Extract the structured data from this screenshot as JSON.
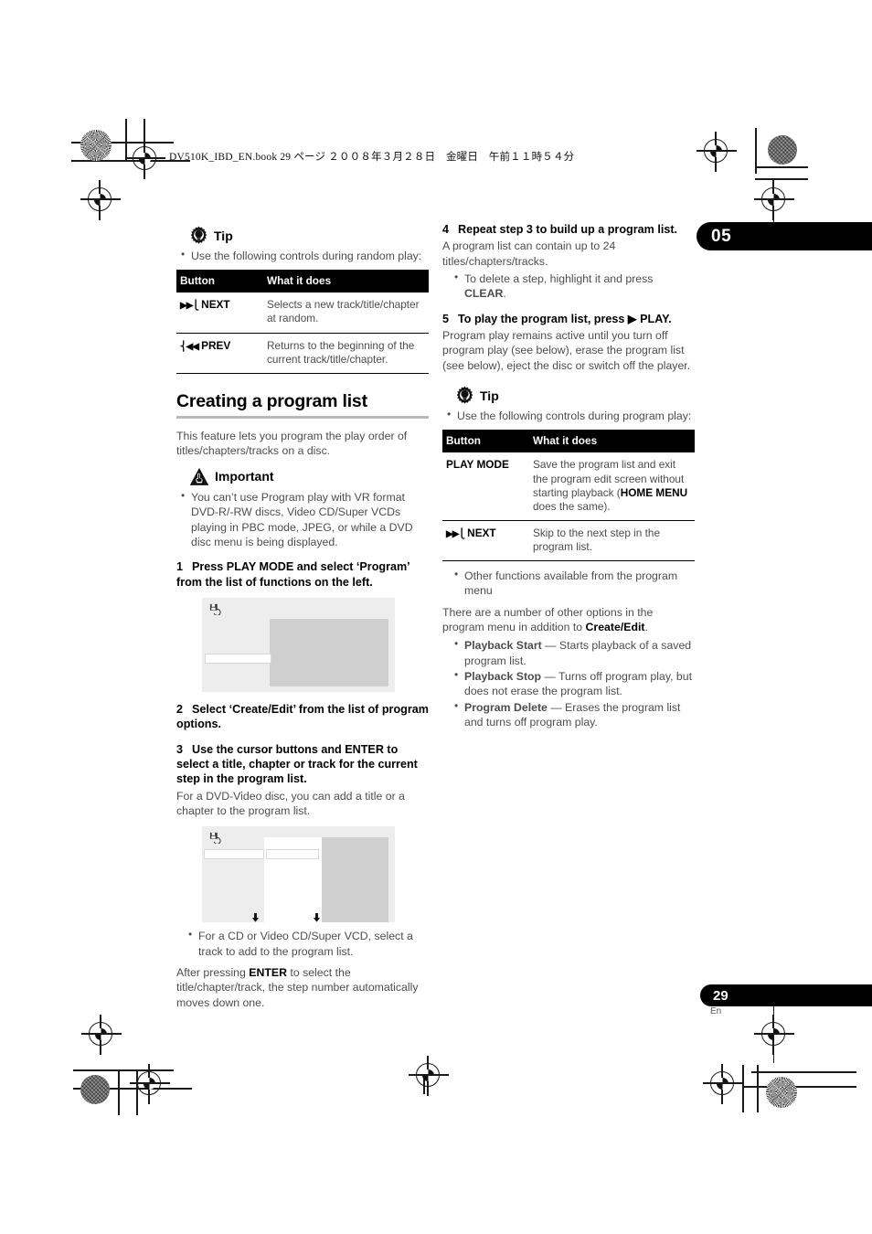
{
  "print": {
    "running_head": "DV510K_IBD_EN.book   29 ページ   ２００８年３月２８日　金曜日　午前１１時５４分"
  },
  "chapter_tab": {
    "number": "05"
  },
  "page_tab": {
    "number": "29",
    "language": "En"
  },
  "left_column": {
    "tip": {
      "icon": "gear-icon",
      "heading": "Tip",
      "bullets": [
        "Use the following controls during random play:"
      ],
      "table": {
        "headers": [
          "Button",
          "What it does"
        ],
        "rows": [
          {
            "glyph": "▶▶⎩",
            "button": "NEXT",
            "desc": "Selects a new track/title/chapter at random."
          },
          {
            "glyph": "⎨◀◀",
            "button": "PREV",
            "desc": "Returns to the beginning of the current track/title/chapter."
          }
        ]
      }
    },
    "section": {
      "title": "Creating a program list",
      "intro": "This feature lets you program the play order of titles/chapters/tracks on a disc.",
      "important": {
        "icon": "warning-icon",
        "heading": "Important",
        "bullets": [
          "You can’t use Program play with VR format DVD-R/-RW discs, Video CD/Super VCDs playing in PBC mode, JPEG, or while a DVD disc menu is being displayed."
        ]
      },
      "steps": [
        {
          "num": "1",
          "text": "Press PLAY MODE and select ‘Program’ from the list of functions on the left.",
          "figure": "program-play-mode-screen"
        },
        {
          "num": "2",
          "text": "Select ‘Create/Edit’ from the list of program options."
        },
        {
          "num": "3",
          "text": "Use the cursor buttons and ENTER to select a title, chapter or track for the current step in the program list.",
          "body": "For a DVD-Video disc, you can add a title or a chapter to the program list.",
          "figure": "program-edit-screen"
        }
      ],
      "after_figure_bullets": [
        "For a CD or Video CD/Super VCD, select a track to add to the program list."
      ],
      "after_figure_body_parts": [
        {
          "text": "After pressing ",
          "bold": false
        },
        {
          "text": "ENTER",
          "bold": true
        },
        {
          "text": " to select the title/chapter/track, the step number automatically moves down one.",
          "bold": false
        }
      ]
    }
  },
  "right_column": {
    "steps": [
      {
        "num": "4",
        "text": "Repeat step 3 to build up a program list.",
        "body": "A program list can contain up to 24 titles/chapters/tracks.",
        "bullet_parts": [
          {
            "text": "To delete a step, highlight it and press ",
            "bold": false
          },
          {
            "text": "CLEAR",
            "bold": true
          },
          {
            "text": ".",
            "bold": false
          }
        ]
      },
      {
        "num": "5",
        "text": "To play the program list, press ▶ PLAY.",
        "body": "Program play remains active until you turn off program play (see below), erase the program list (see below), eject the disc or switch off the player."
      }
    ],
    "tip": {
      "icon": "gear-icon",
      "heading": "Tip",
      "bullets": [
        "Use the following controls during program play:"
      ],
      "table": {
        "headers": [
          "Button",
          "What it does"
        ],
        "rows": [
          {
            "glyph": "",
            "button": "PLAY MODE",
            "desc_parts": [
              {
                "text": "Save the program list and exit the program edit screen without starting playback (",
                "bold": false
              },
              {
                "text": "HOME MENU",
                "bold": true
              },
              {
                "text": " does the same).",
                "bold": false
              }
            ]
          },
          {
            "glyph": "▶▶⎩",
            "button": "NEXT",
            "desc_parts": [
              {
                "text": "Skip to the next step in the program list.",
                "bold": false
              }
            ]
          }
        ]
      }
    },
    "other_functions": {
      "bullet": "Other functions available from the program menu",
      "body_parts": [
        {
          "text": "There are a number of other options in the program menu in addition to ",
          "bold": false
        },
        {
          "text": "Create/Edit",
          "bold": true
        },
        {
          "text": ".",
          "bold": false
        }
      ],
      "options": [
        {
          "name": "Playback Start",
          "desc": " — Starts playback of a saved program list."
        },
        {
          "name": "Playback Stop",
          "desc": " — Turns off program play, but does not erase the program list."
        },
        {
          "name": "Program Delete",
          "desc": " — Erases the program list and turns off program play."
        }
      ]
    }
  }
}
